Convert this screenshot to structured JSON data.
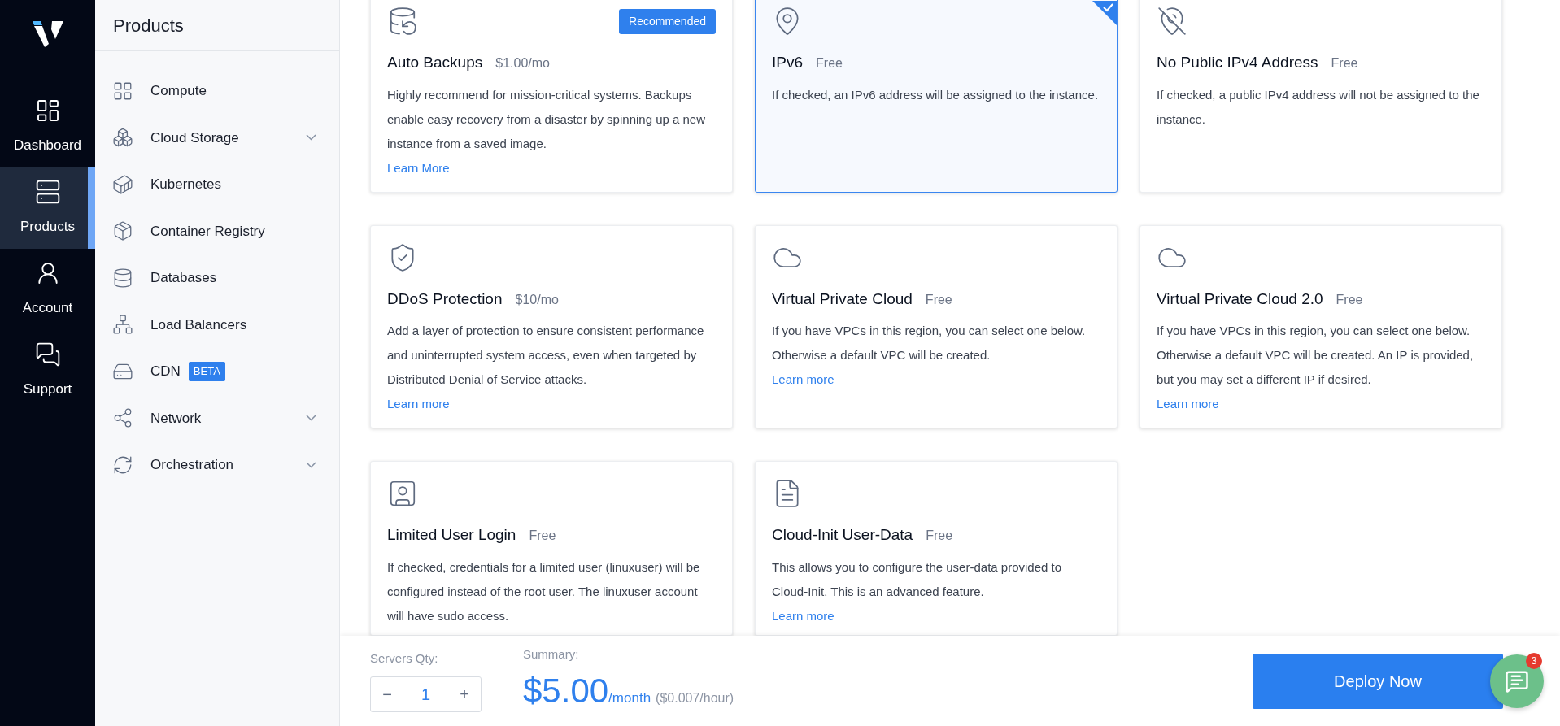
{
  "nav": {
    "items": [
      {
        "label": "Dashboard",
        "selected": false
      },
      {
        "label": "Products",
        "selected": true
      },
      {
        "label": "Account",
        "selected": false
      },
      {
        "label": "Support",
        "selected": false
      }
    ]
  },
  "sidebar": {
    "title": "Products",
    "items": [
      {
        "label": "Compute",
        "kind": "link"
      },
      {
        "label": "Cloud Storage",
        "kind": "group"
      },
      {
        "label": "Kubernetes",
        "kind": "link"
      },
      {
        "label": "Container Registry",
        "kind": "link"
      },
      {
        "label": "Databases",
        "kind": "link"
      },
      {
        "label": "Load Balancers",
        "kind": "link"
      },
      {
        "label": "CDN",
        "kind": "link",
        "badge": "BETA"
      },
      {
        "label": "Network",
        "kind": "group"
      },
      {
        "label": "Orchestration",
        "kind": "group"
      }
    ]
  },
  "cards": [
    {
      "title": "Auto Backups",
      "price": "$1.00/mo",
      "badge": "Recommended",
      "description": "Highly recommend for mission-critical systems. Backups enable easy recovery from a disaster by spinning up a new instance from a saved image.",
      "link": "Learn More",
      "selected": false
    },
    {
      "title": "IPv6",
      "price": "Free",
      "description": "If checked, an IPv6 address will be assigned to the instance.",
      "selected": true
    },
    {
      "title": "No Public IPv4 Address",
      "price": "Free",
      "description": "If checked, a public IPv4 address will not be assigned to the instance.",
      "selected": false
    },
    {
      "title": "DDoS Protection",
      "price": "$10/mo",
      "description": "Add a layer of protection to ensure consistent performance and uninterrupted system access, even when targeted by Distributed Denial of Service attacks.",
      "link": "Learn more",
      "selected": false
    },
    {
      "title": "Virtual Private Cloud",
      "price": "Free",
      "description": "If you have VPCs in this region, you can select one below. Otherwise a default VPC will be created.",
      "link": "Learn more",
      "selected": false
    },
    {
      "title": "Virtual Private Cloud 2.0",
      "price": "Free",
      "description": "If you have VPCs in this region, you can select one below. Otherwise a default VPC will be created. An IP is provided, but you may set a different IP if desired.",
      "link": "Learn more",
      "selected": false
    },
    {
      "title": "Limited User Login",
      "price": "Free",
      "description": "If checked, credentials for a limited user (linuxuser) will be configured instead of the root user. The linuxuser account will have sudo access.",
      "selected": false
    },
    {
      "title": "Cloud-Init User-Data",
      "price": "Free",
      "description": "This allows you to configure the user-data provided to Cloud-Init. This is an advanced feature.",
      "link": "Learn more",
      "selected": false
    }
  ],
  "footer": {
    "qty_label": "Servers Qty:",
    "decrement": "−",
    "qty": "1",
    "increment": "+",
    "summary_label": "Summary:",
    "price": "$5.00",
    "period": "/month",
    "hourly": "($0.007/hour)",
    "button": "Deploy Now"
  },
  "chat": {
    "badge": "3"
  }
}
